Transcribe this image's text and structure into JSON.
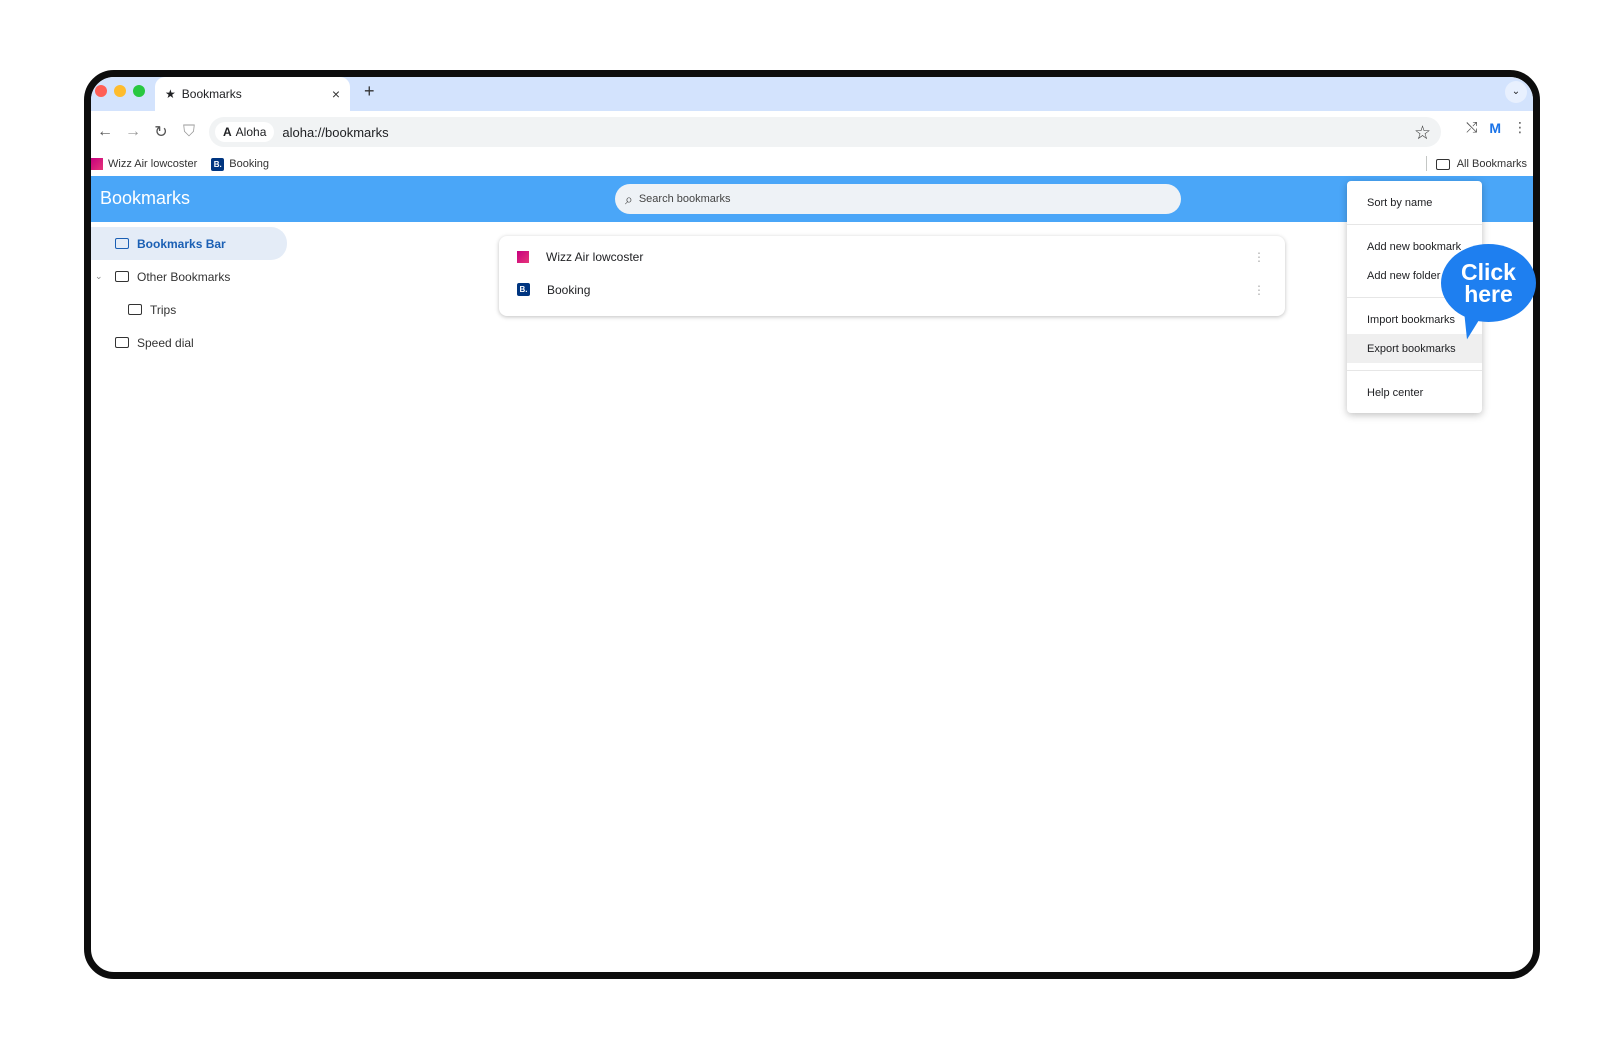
{
  "tab": {
    "title": "Bookmarks",
    "close": "×",
    "new_tab": "+"
  },
  "toolbar": {
    "back": "←",
    "forward": "→",
    "reload": "↻",
    "site_chip": "Aloha",
    "url": "aloha://bookmarks",
    "profile": "M"
  },
  "bookmarks_bar": {
    "items": [
      {
        "label": "Wizz Air lowcoster",
        "icon": "wizz-favicon"
      },
      {
        "label": "Booking",
        "icon": "booking-favicon"
      }
    ],
    "all_bookmarks": "All Bookmarks"
  },
  "header": {
    "title": "Bookmarks",
    "search_placeholder": "Search bookmarks"
  },
  "sidebar": {
    "items": [
      {
        "label": "Bookmarks Bar"
      },
      {
        "label": "Other Bookmarks"
      },
      {
        "label": "Trips"
      },
      {
        "label": "Speed dial"
      }
    ]
  },
  "list": {
    "items": [
      {
        "label": "Wizz Air lowcoster"
      },
      {
        "label": "Booking",
        "favicon_text": "B."
      }
    ]
  },
  "menu": {
    "items": [
      "Sort by name",
      "Add new bookmark",
      "Add new folder",
      "Import bookmarks",
      "Export bookmarks",
      "Help center"
    ],
    "highlighted": "Export bookmarks"
  },
  "callout": {
    "line1": "Click",
    "line2": "here"
  },
  "colors": {
    "accent": "#4aa6f8",
    "callout": "#1e7ff0",
    "tabstrip": "#d3e3fd"
  }
}
